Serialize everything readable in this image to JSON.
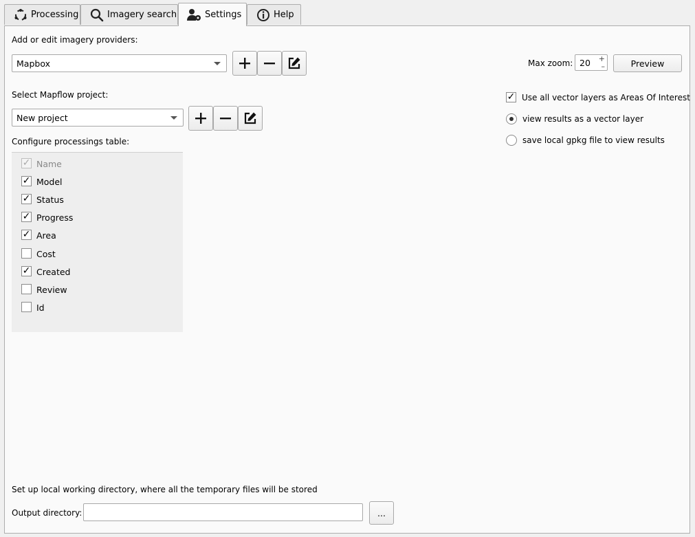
{
  "tabs": [
    {
      "label": "Processing",
      "icon": "processing-cycle-icon"
    },
    {
      "label": "Imagery search",
      "icon": "magnifier-icon"
    },
    {
      "label": "Settings",
      "icon": "user-settings-icon"
    },
    {
      "label": "Help",
      "icon": "info-icon"
    }
  ],
  "providers": {
    "label": "Add or edit imagery providers:",
    "selected": "Mapbox",
    "max_zoom_label": "Max zoom:",
    "max_zoom_value": "20",
    "preview_label": "Preview"
  },
  "project": {
    "label": "Select Mapflow project:",
    "selected": "New project"
  },
  "options": {
    "use_all_vector_layers": {
      "label": "Use all vector layers as Areas Of Interest",
      "checked": true
    },
    "view_results_vector": {
      "label": "view results as a vector layer",
      "selected": true
    },
    "save_local_gpkg": {
      "label": "save local gpkg file to view results",
      "selected": false
    }
  },
  "table_config": {
    "label": "Configure processings table:",
    "columns": [
      {
        "name": "Name",
        "checked": true,
        "disabled": true
      },
      {
        "name": "Model",
        "checked": true
      },
      {
        "name": "Status",
        "checked": true
      },
      {
        "name": "Progress",
        "checked": true
      },
      {
        "name": "Area",
        "checked": true
      },
      {
        "name": "Cost",
        "checked": false
      },
      {
        "name": "Created",
        "checked": true
      },
      {
        "name": "Review",
        "checked": false
      },
      {
        "name": "Id",
        "checked": false
      }
    ]
  },
  "working_dir": {
    "label": "Set up local working directory, where all the temporary files will be stored",
    "output_label": "Output directory:",
    "output_value": "",
    "browse_label": "..."
  }
}
